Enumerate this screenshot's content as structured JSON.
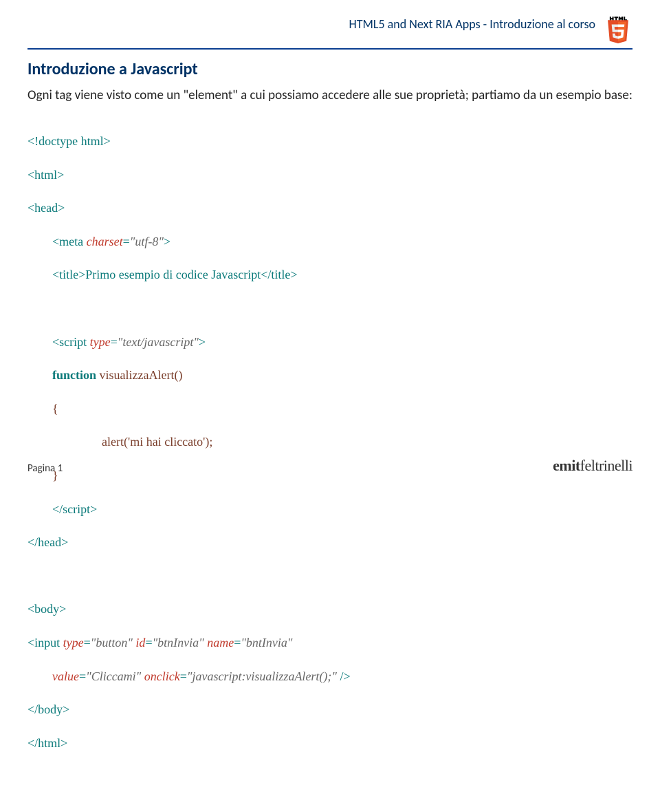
{
  "header": {
    "course_title": "HTML5 and Next RIA Apps - Introduzione al corso"
  },
  "section": {
    "title": "Introduzione a Javascript",
    "intro": "Ogni tag viene visto come un \"element\" a cui possiamo accedere alle sue proprietà; partiamo da un esempio base:"
  },
  "code": {
    "l1": "<!doctype html>",
    "l2": "<html>",
    "l3": "<head>",
    "l4a": "<meta ",
    "l4b": "charset",
    "l4c": "=",
    "l4d": "\"utf-8\"",
    "l4e": ">",
    "l5": "<title>Primo esempio di codice Javascript</title>",
    "l6a": "<script ",
    "l6b": "type",
    "l6c": "=",
    "l6d": "\"text/javascript\"",
    "l6e": ">",
    "l7a": "function",
    "l7b": " visualizzaAlert()",
    "l8": "{",
    "l9": "alert('mi hai cliccato');",
    "l10": "}",
    "l11": "</script>",
    "l12": "</head>",
    "l13": "<body>",
    "l14a": "<input ",
    "l14b": "type",
    "l14c": "=",
    "l14d": "\"button\"",
    "l14e": " id",
    "l14f": "=",
    "l14g": "\"btnInvia\"",
    "l14h": " name",
    "l14i": "=",
    "l14j": "\"bntInvia\"",
    "l15a": "value",
    "l15b": "=",
    "l15c": "\"Cliccami\"",
    "l15d": " onclick",
    "l15e": "=",
    "l15f": "\"javascript:visualizzaAlert();\"",
    "l15g": " />",
    "l16": "</body>",
    "l17": "</html>"
  },
  "footer": {
    "page": "Pagina 1",
    "brand1": "emit",
    "brand2": "feltrinelli"
  }
}
